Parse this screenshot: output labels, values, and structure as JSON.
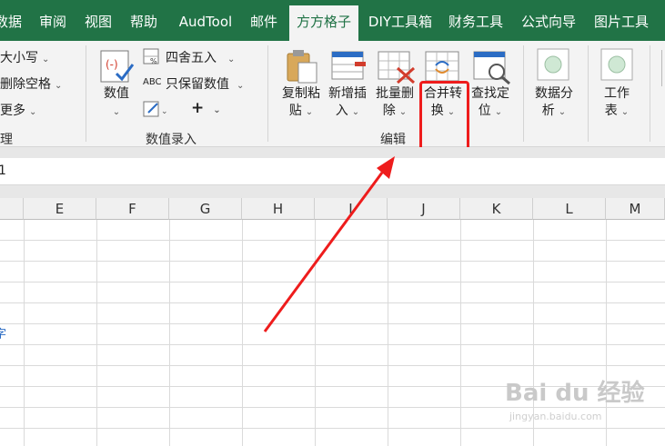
{
  "menu": {
    "tabs": [
      "数据",
      "审阅",
      "视图",
      "帮助",
      "AudTool",
      "邮件",
      "方方格子",
      "DIY工具箱",
      "财务工具",
      "公式向导",
      "图片工具"
    ],
    "active_tab": "方方格子"
  },
  "ribbon": {
    "left_group": {
      "item1": "大小写",
      "item2": "删除空格",
      "item3": "更多",
      "group_label": "理"
    },
    "number_group": {
      "value_button": "数值",
      "round_label": "四舍五入",
      "abc_text": "ABC",
      "keep_value_label": "只保留数值",
      "plus_symbol": "+",
      "group_label": "数值录入"
    },
    "edit_group": {
      "copy_paste": [
        "复制粘",
        "贴"
      ],
      "insert": [
        "新增插",
        "入"
      ],
      "batch_delete": [
        "批量删",
        "除"
      ],
      "merge_convert": [
        "合并转",
        "换"
      ],
      "find_locate": [
        "查找定",
        "位"
      ],
      "group_label": "编辑"
    },
    "analysis": [
      "数据分",
      "析"
    ],
    "worksheet": [
      "工作",
      "表"
    ]
  },
  "formula_bar": {
    "name_box": "1"
  },
  "grid": {
    "columns": [
      "E",
      "F",
      "G",
      "H",
      "I",
      "J",
      "K",
      "L",
      "M"
    ],
    "partial_row_text": "字"
  },
  "watermark": {
    "main": "Bai du 经验",
    "sub": "jingyan.baidu.com"
  },
  "colors": {
    "accent": "#217346",
    "highlight": "#ee1c1c",
    "arrow": "#ee1c1c"
  }
}
